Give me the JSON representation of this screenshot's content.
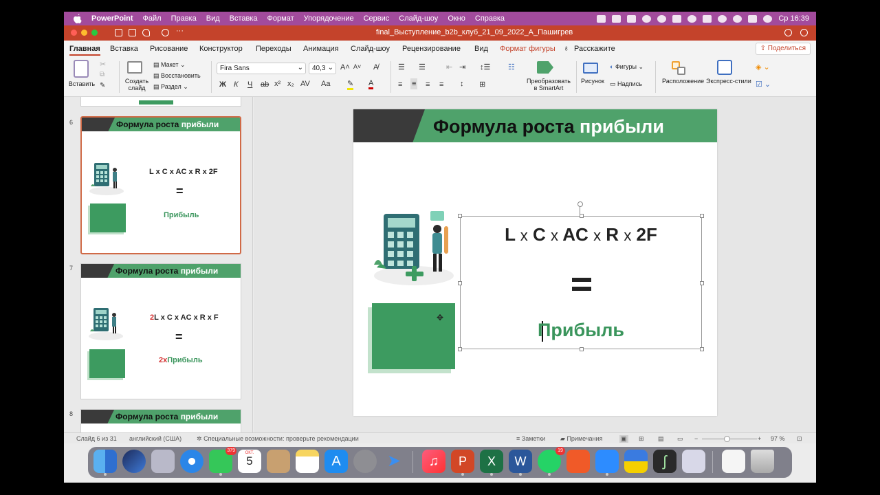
{
  "menubar": {
    "app_name": "PowerPoint",
    "items": [
      "Файл",
      "Правка",
      "Вид",
      "Вставка",
      "Формат",
      "Упорядочение",
      "Сервис",
      "Слайд-шоу",
      "Окно",
      "Справка"
    ],
    "clock": "Ср 16:39"
  },
  "window": {
    "title": "final_Выступление_b2b_клуб_21_09_2022_А_Пашигрев"
  },
  "ribbon_tabs": {
    "items": [
      "Главная",
      "Вставка",
      "Рисование",
      "Конструктор",
      "Переходы",
      "Анимация",
      "Слайд-шоу",
      "Рецензирование",
      "Вид",
      "Формат фигуры"
    ],
    "tell_me": "Расскажите",
    "share": "Поделиться"
  },
  "ribbon": {
    "paste": "Вставить",
    "new_slide_line1": "Создать",
    "new_slide_line2": "слайд",
    "layout": "Макет",
    "reset": "Восстановить",
    "section": "Раздел",
    "font_name": "Fira Sans",
    "font_size": "40,3",
    "bold": "Ж",
    "italic": "К",
    "underline": "Ч",
    "convert_smartart_line1": "Преобразовать",
    "convert_smartart_line2": "в SmartArt",
    "picture": "Рисунок",
    "shapes": "Фигуры",
    "textbox": "Надпись",
    "arrange": "Расположение",
    "quick_styles": "Экспресс-стили"
  },
  "thumbnails": [
    {
      "number": "6",
      "title_main": "Формула роста",
      "title_accent": "прибыли",
      "formula_prefix": "",
      "formula": "L x C x AC x R x 2F",
      "equals": "=",
      "profit_prefix": "",
      "profit": "Прибыль"
    },
    {
      "number": "7",
      "title_main": "Формула роста",
      "title_accent": "прибыли",
      "formula_prefix": "2",
      "formula": "L x C x AC x R x F",
      "equals": "=",
      "profit_prefix": "2x",
      "profit": "Прибыль"
    },
    {
      "number": "8",
      "title_main": "Формула роста",
      "title_accent": "прибыли"
    }
  ],
  "slide": {
    "title_main": "Формула роста",
    "title_accent": "прибыли",
    "formula_terms": [
      "L",
      "C",
      "AC",
      "R",
      "2F"
    ],
    "formula_operator": "x",
    "profit": "Прибыль"
  },
  "statusbar": {
    "slide_info": "Слайд 6 из 31",
    "language": "английский (США)",
    "accessibility": "Специальные возможности: проверьте рекомендации",
    "notes": "Заметки",
    "comments": "Примечания",
    "zoom": "97 %"
  },
  "dock": {
    "messages_badge": "379",
    "calendar_month": "ОКТ.",
    "calendar_day": "5",
    "whatsapp_badge": "19"
  },
  "colors": {
    "menubar": "#a24b9c",
    "titlebar": "#c4432b",
    "slide_green": "#4fa26b",
    "profit_green": "#3a955c",
    "accent_red": "#d32f2f"
  }
}
